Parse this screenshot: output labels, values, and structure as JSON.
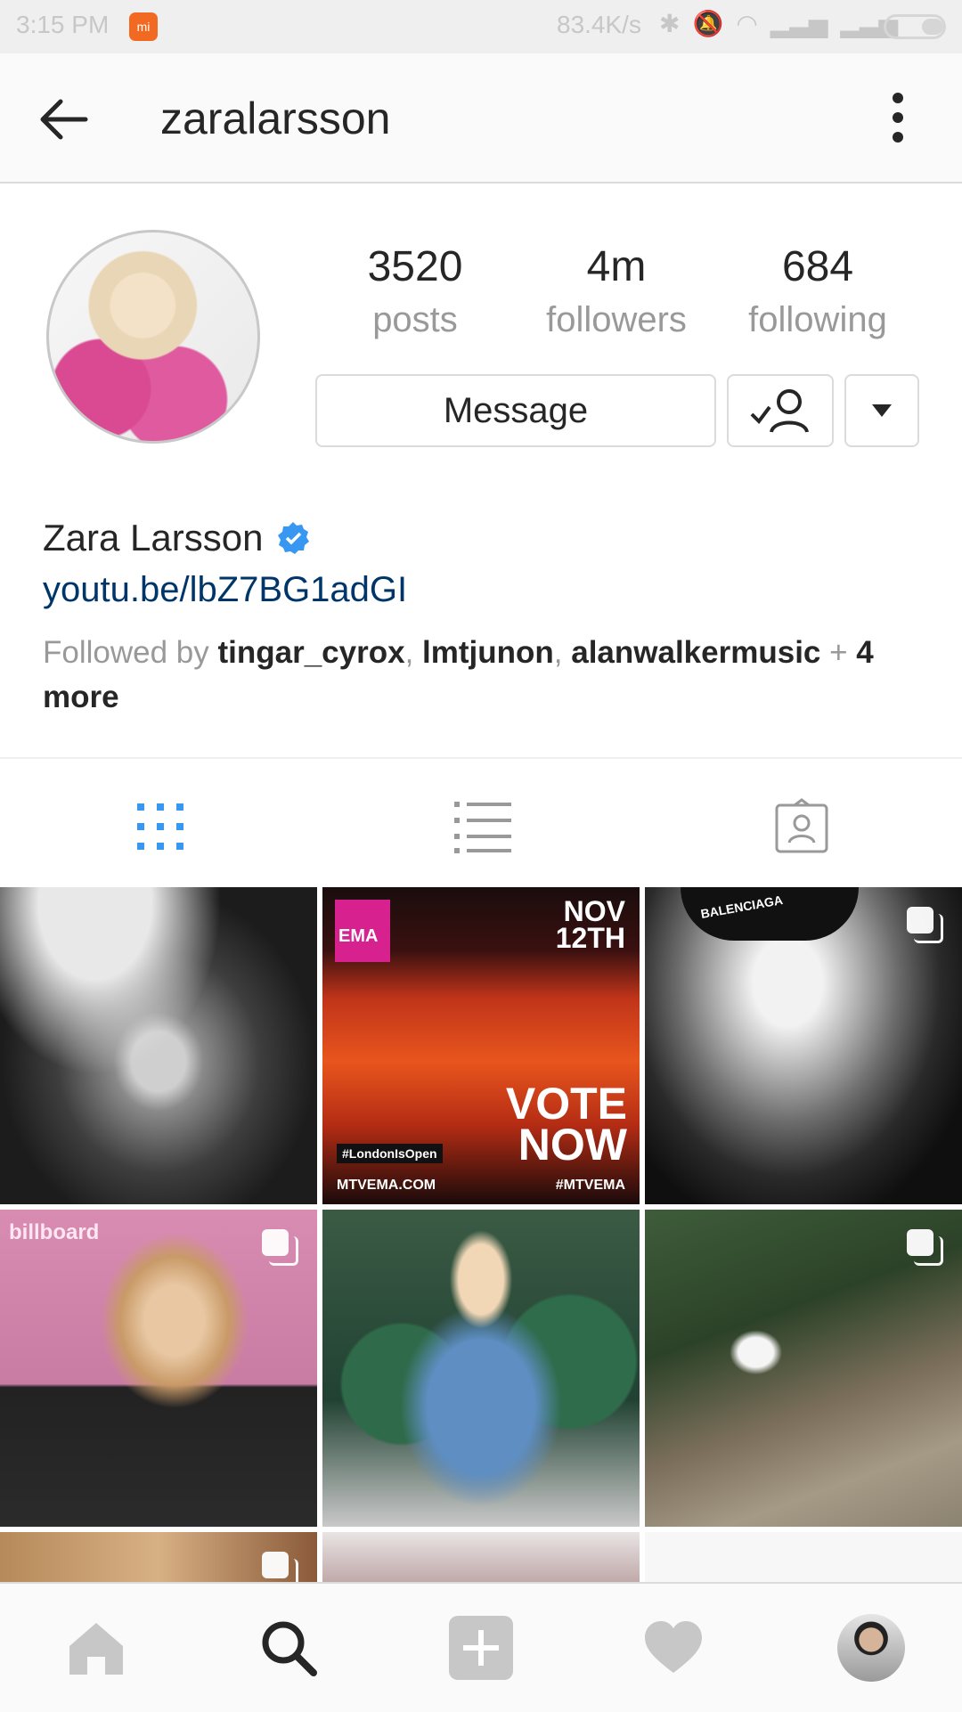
{
  "status_bar": {
    "time": "3:15 PM",
    "net_speed": "83.4K/s"
  },
  "header": {
    "username": "zaralarsson"
  },
  "profile": {
    "stats": [
      {
        "value": "3520",
        "label": "posts"
      },
      {
        "value": "4m",
        "label": "followers"
      },
      {
        "value": "684",
        "label": "following"
      }
    ],
    "message_label": "Message",
    "full_name": "Zara Larsson",
    "link": "youtu.be/lbZ7BG1adGI",
    "followed_by_prefix": "Followed by ",
    "followed_by_users": [
      "tingar_cyrox",
      "lmtjunon",
      "alanwalkermusic"
    ],
    "followed_by_more": "4 more"
  },
  "grid_texts": {
    "ema_date": "NOV 12TH",
    "ema_vote": "VOTE NOW",
    "ema_tag": "#LondonIsOpen",
    "ema_site": "MTVEMA.COM",
    "ema_hashtag": "#MTVEMA",
    "ema_logo": "EMA",
    "cap_brand": "BALENCIAGA",
    "billboard": "billboard"
  },
  "colors": {
    "accent": "#3897f0",
    "link": "#003569",
    "muted": "#999999",
    "text": "#262626"
  }
}
